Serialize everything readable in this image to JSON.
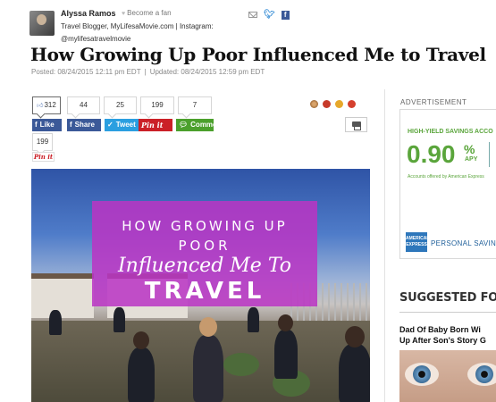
{
  "author": {
    "name": "Alyssa Ramos",
    "become_fan": "Become a fan",
    "bio": "Travel Blogger, MyLifesaMovie.com | Instagram: @mylifesatravelmovie"
  },
  "article": {
    "title": "How Growing Up Poor Influenced Me to Travel",
    "posted": "Posted: 08/24/2015 12:11 pm EDT",
    "updated": "Updated: 08/24/2015 12:59 pm EDT",
    "separator": "|"
  },
  "share": {
    "counts": {
      "like": "312",
      "share": "44",
      "tweet": "25",
      "pin": "199",
      "comment": "7",
      "pin_below": "199"
    },
    "labels": {
      "like": "Like",
      "share": "Share",
      "tweet": "Tweet",
      "pin": "Pin it",
      "comment": "Comment",
      "pin_below": "Pin it"
    }
  },
  "hero": {
    "line1": "HOW GROWING UP",
    "line2": "POOR",
    "line3": "Influenced Me To",
    "line4": "TRAVEL",
    "banner_color": "#ba34c4"
  },
  "sidebar": {
    "ad_label": "ADVERTISEMENT",
    "ad": {
      "title": "HIGH-YIELD SAVINGS ACCO",
      "rate": "0.90",
      "pct": "%",
      "apy": "APY",
      "fine": "Accounts offered by American Express",
      "logo": "AMERICAN EXPRESS",
      "tagline": "PERSONAL SAVIN"
    },
    "suggested": {
      "heading": "SUGGESTED FOR",
      "item_title_1": "Dad Of Baby Born Wi",
      "item_title_2": "Up After Son's Story G"
    }
  },
  "icons": [
    "mail-icon",
    "twitter-icon",
    "facebook-icon",
    "print-icon"
  ],
  "colors": {
    "facebook": "#3b5998",
    "twitter": "#2b9fe0",
    "pinterest": "#cb2027",
    "comment": "#4ba02c",
    "ad_green": "#5aa53b"
  }
}
